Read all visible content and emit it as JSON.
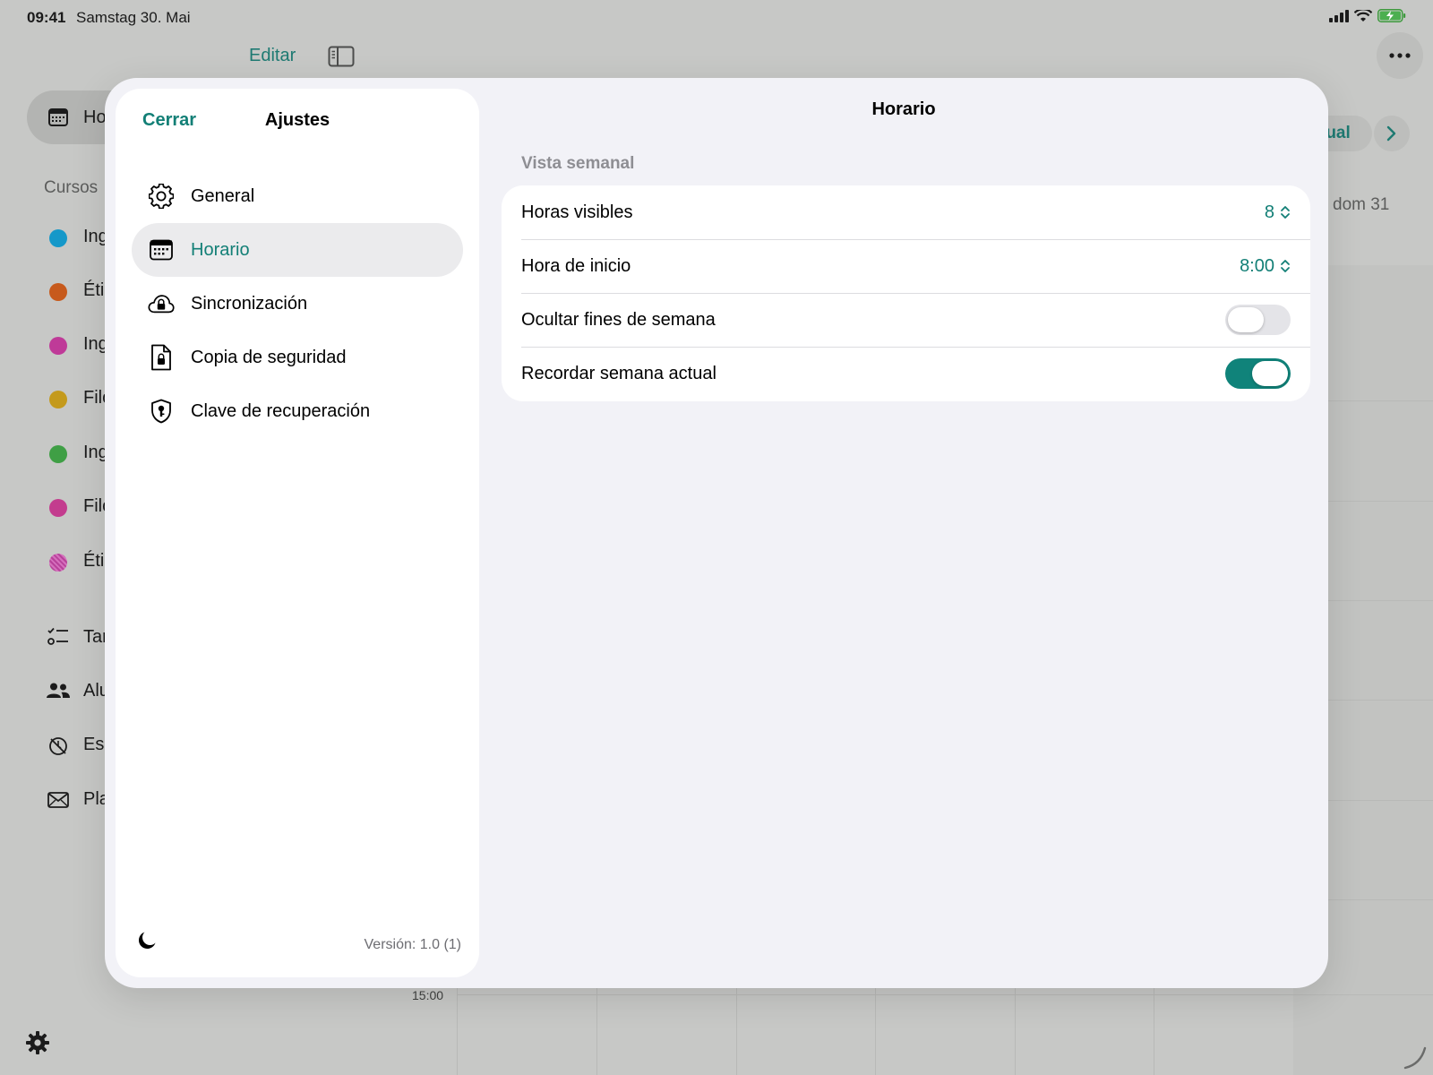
{
  "status_bar": {
    "time": "09:41",
    "date": "Samstag 30. Mai"
  },
  "background": {
    "toolbar_edit": "Editar",
    "sidebar_selected": "Ho",
    "courses_title": "Cursos",
    "courses": [
      {
        "label": "Ing",
        "color": "#1598c9"
      },
      {
        "label": "Éti",
        "color": "#c75a1c"
      },
      {
        "label": "Ing",
        "color": "#bf3a98"
      },
      {
        "label": "Filo",
        "color": "#c49a1c"
      },
      {
        "label": "Ing",
        "color": "#3f9f45"
      },
      {
        "label": "Filo",
        "color": "#c33c8e"
      },
      {
        "label": "Éti",
        "color": "#b8429a"
      }
    ],
    "nav_items": [
      {
        "label": "Tar",
        "icon": "checklist-icon"
      },
      {
        "label": "Alu",
        "icon": "people-icon"
      },
      {
        "label": "Esc",
        "icon": "clock-slash-icon"
      },
      {
        "label": "Pla",
        "icon": "envelope-icon"
      }
    ],
    "today_button": "tual",
    "day_header": "dom 31",
    "time_label": "15:00"
  },
  "settings": {
    "close_label": "Cerrar",
    "title": "Ajustes",
    "menu": [
      {
        "label": "General",
        "icon": "gear-icon",
        "selected": false
      },
      {
        "label": "Horario",
        "icon": "calendar-icon",
        "selected": true
      },
      {
        "label": "Sincronización",
        "icon": "cloud-lock-icon",
        "selected": false
      },
      {
        "label": "Copia de seguridad",
        "icon": "document-lock-icon",
        "selected": false
      },
      {
        "label": "Clave de recuperación",
        "icon": "shield-key-icon",
        "selected": false
      }
    ],
    "version": "Versión: 1.0 (1)"
  },
  "detail": {
    "title": "Horario",
    "section_title": "Vista semanal",
    "rows": {
      "visible_hours": {
        "label": "Horas visibles",
        "value": "8"
      },
      "start_time": {
        "label": "Hora de inicio",
        "value": "8:00"
      },
      "hide_weekends": {
        "label": "Ocultar fines de semana",
        "on": false
      },
      "remember_week": {
        "label": "Recordar semana actual",
        "on": true
      }
    }
  },
  "colors": {
    "accent": "#127f76",
    "toggle_on": "#10837a",
    "toggle_off": "#e4e4e8"
  }
}
